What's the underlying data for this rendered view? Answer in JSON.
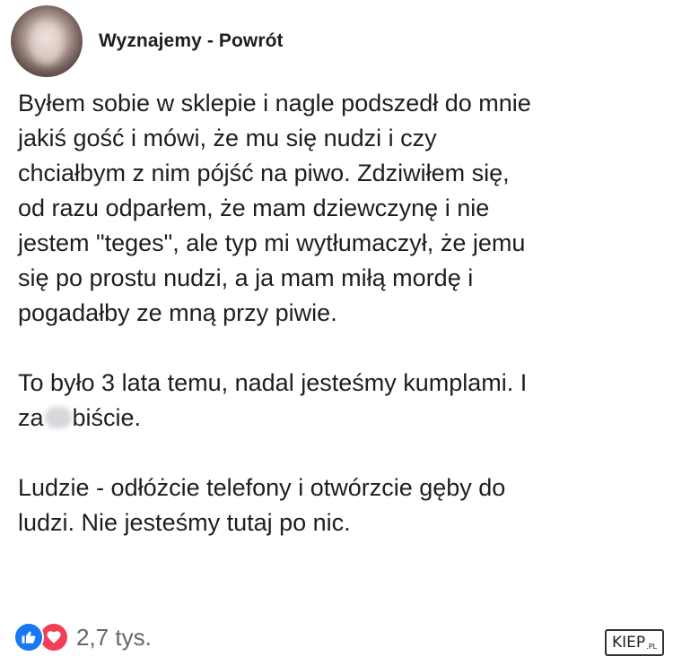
{
  "post": {
    "author": "Wyznajemy - Powrót",
    "paragraphs": [
      {
        "lines": [
          "Byłem sobie w sklepie i nagle podszedł do mnie",
          "jakiś gość i mówi, że mu się nudzi i czy",
          "chciałbym z nim pójść na piwo. Zdziwiłem się,",
          "od razu odparłem, że mam dziewczynę i nie",
          "jestem \"teges\", ale typ mi wytłumaczył, że jemu",
          "się po prostu nudzi, a ja mam miłą mordę i",
          "pogadałby ze mną przy piwie."
        ]
      },
      {
        "lines": [
          "To było 3 lata temu, nadal jesteśmy kumplami. I"
        ],
        "censored_line": {
          "before": "za",
          "after": "biście."
        }
      },
      {
        "lines": [
          "Ludzie - odłóżcie telefony i otwórzcie gęby do",
          "ludzi. Nie jesteśmy tutaj po nic."
        ]
      }
    ]
  },
  "reactions": {
    "icons": [
      "like-icon",
      "love-icon"
    ],
    "count": "2,7 tys.",
    "colors": {
      "like": "#1877f2",
      "love": "#f33e58"
    }
  },
  "watermark": {
    "brand": "KIEP",
    "tld": ".PL"
  }
}
